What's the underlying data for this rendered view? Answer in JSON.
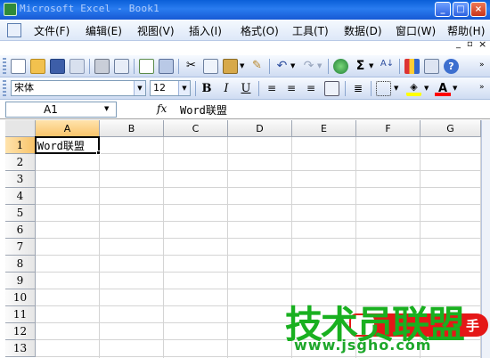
{
  "window": {
    "title": "Microsoft Excel - Book1"
  },
  "menu": {
    "items": [
      "文件(F)",
      "编辑(E)",
      "视图(V)",
      "插入(I)",
      "格式(O)",
      "工具(T)",
      "数据(D)",
      "窗口(W)",
      "帮助(H)"
    ]
  },
  "toolbar": {
    "standard_icons": [
      "new-icon",
      "open-icon",
      "save-icon",
      "permission-icon",
      "print-icon",
      "print-preview-icon",
      "spelling-icon",
      "research-icon",
      "cut-icon",
      "copy-icon",
      "paste-icon",
      "format-painter-icon",
      "undo-icon",
      "redo-icon",
      "hyperlink-icon",
      "autosum-icon",
      "sort-ascending-icon",
      "chart-wizard-icon",
      "help-icon"
    ],
    "autosum_symbol": "Σ",
    "sort_symbol": "A↓",
    "help_symbol": "?"
  },
  "formatting": {
    "font_name": "宋体",
    "font_size": "12",
    "bold": "B",
    "italic": "I",
    "underline": "U",
    "font_color_letter": "A",
    "highlight_color": "#ffff00",
    "font_color": "#ff0000"
  },
  "formula_bar": {
    "name_box": "A1",
    "fx_label": "fx",
    "content": "Word联盟"
  },
  "sheet": {
    "columns": [
      "A",
      "B",
      "C",
      "D",
      "E",
      "F",
      "G"
    ],
    "rows": [
      "1",
      "2",
      "3",
      "4",
      "5",
      "6",
      "7",
      "8",
      "9",
      "10",
      "11",
      "12",
      "13"
    ],
    "active_cell": "A1",
    "cell_a1": "Word联盟"
  },
  "watermark": {
    "main_text": "技术员联盟",
    "url_text": "www.jsgho.com",
    "badge_text": "手"
  },
  "colors": {
    "title_blue": "#1759d4",
    "selected_header": "#f9c46a",
    "watermark_green": "#19b020",
    "watermark_red": "#e51717"
  }
}
